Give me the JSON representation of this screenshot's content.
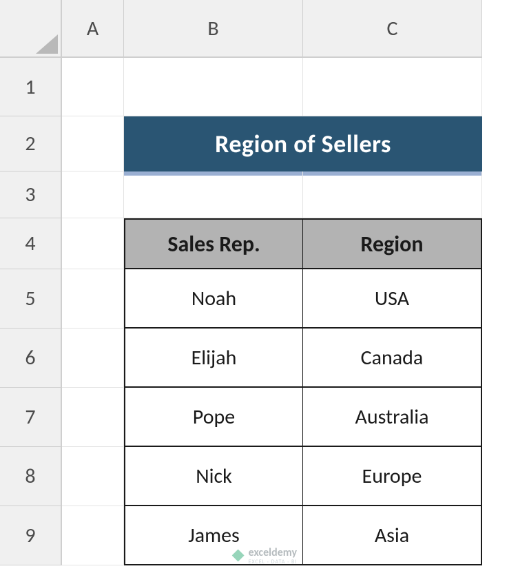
{
  "columns": [
    "A",
    "B",
    "C"
  ],
  "rows": [
    "1",
    "2",
    "3",
    "4",
    "5",
    "6",
    "7",
    "8",
    "9"
  ],
  "title": "Region of Sellers",
  "table": {
    "headers": [
      "Sales Rep.",
      "Region"
    ],
    "data": [
      [
        "Noah",
        "USA"
      ],
      [
        "Elijah",
        "Canada"
      ],
      [
        "Pope",
        "Australia"
      ],
      [
        "Nick",
        "Europe"
      ],
      [
        "James",
        "Asia"
      ]
    ]
  },
  "watermark": {
    "brand": "exceldemy",
    "tagline": "EXCEL · DATA · BI"
  }
}
